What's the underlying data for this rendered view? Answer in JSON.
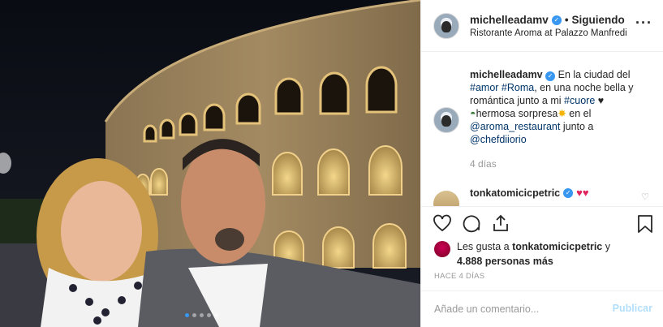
{
  "header": {
    "username": "michelleadamv",
    "follow_status": "Siguiendo",
    "separator": "•",
    "location": "Ristorante Aroma at Palazzo Manfredi",
    "more_icon": "ellipsis-icon"
  },
  "caption": {
    "username": "michelleadamv",
    "text_1": "En la ciudad del",
    "tag_amor": "#amor",
    "tag_roma": "#Roma",
    "text_2": ", en una noche bella y romántica junto a mi",
    "tag_cuore": "#cuore",
    "text_3": "hermosa sorpresa",
    "text_4": "en el",
    "mention_restaurant": "@aroma_restaurant",
    "text_5": "junto a",
    "mention_chef": "@chefdiiorio",
    "emoji_heart": "♥",
    "emoji_sparkle": "✸",
    "emoji_glasses": "◓"
  },
  "time_ago": "4 días",
  "comment": {
    "username": "tonkatomicicpetric",
    "hearts": "♥♥"
  },
  "likes": {
    "prefix": "Les gusta a",
    "user": "tonkatomicicpetric",
    "suffix": "y",
    "count": "4.888 personas más"
  },
  "timestamp": "HACE 4 DÍAS",
  "composer": {
    "placeholder": "Añade un comentario...",
    "publish": "Publicar"
  },
  "colors": {
    "accent": "#3897f0",
    "publish_disabled": "#b2dffc",
    "hashtag": "#003569"
  },
  "carousel": {
    "total": 5,
    "active": 1
  }
}
